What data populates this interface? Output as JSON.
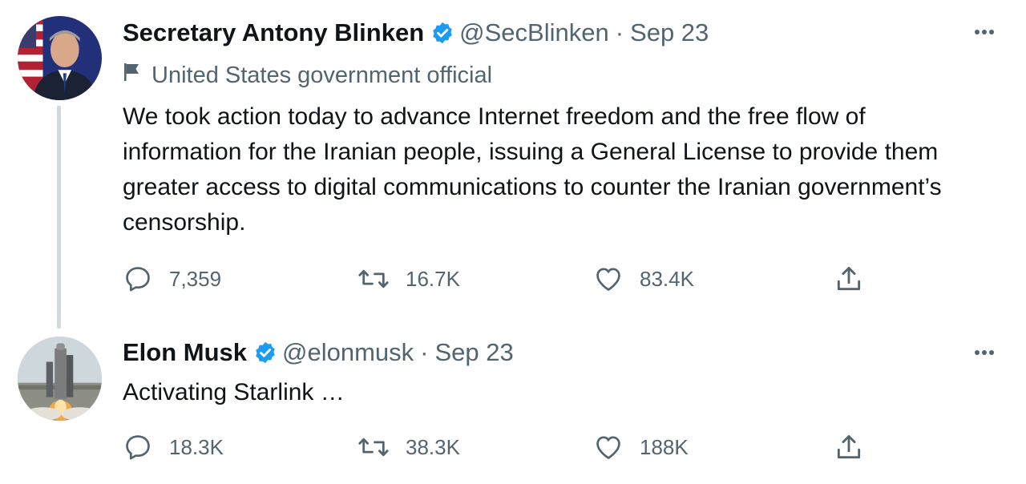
{
  "tweets": [
    {
      "display_name": "Secretary Antony Blinken",
      "handle": "@SecBlinken",
      "separator": "·",
      "date": "Sep 23",
      "label": "United States government official",
      "text": "We took action today to advance Internet freedom and the free flow of information for the Iranian people, issuing a General License to provide them greater access to digital communications to counter the Iranian government’s censorship.",
      "replies": "7,359",
      "retweets": "16.7K",
      "likes": "83.4K"
    },
    {
      "display_name": "Elon Musk",
      "handle": "@elonmusk",
      "separator": "·",
      "date": "Sep 23",
      "text": "Activating Starlink …",
      "replies": "18.3K",
      "retweets": "38.3K",
      "likes": "188K"
    }
  ],
  "icons": {
    "verified": "verified-badge-icon",
    "more": "more-options-icon",
    "flag": "government-flag-icon",
    "reply": "reply-icon",
    "retweet": "retweet-icon",
    "like": "like-icon",
    "share": "share-icon"
  },
  "colors": {
    "verified_blue": "#1d9bf0",
    "secondary_text": "#536471",
    "primary_text": "#0f1419",
    "thread_line": "#cfd9de"
  }
}
